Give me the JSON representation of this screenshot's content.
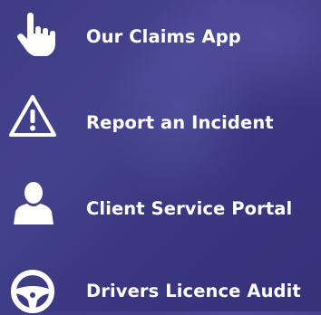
{
  "menu": {
    "items": [
      {
        "label": "Our Claims App",
        "icon": "hand-pointer-icon"
      },
      {
        "label": "Report an Incident",
        "icon": "warning-triangle-icon"
      },
      {
        "label": "Client Service Portal",
        "icon": "user-icon"
      },
      {
        "label": "Drivers Licence Audit",
        "icon": "steering-wheel-icon"
      }
    ]
  },
  "colors": {
    "background": "#3f3c86",
    "text": "#ffffff",
    "icon": "#ffffff"
  }
}
